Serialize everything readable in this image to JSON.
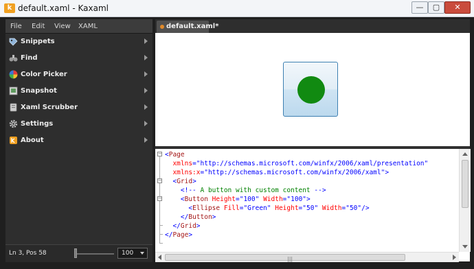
{
  "window": {
    "title": "default.xaml - Kaxaml",
    "app_icon_letter": "k",
    "minimize_glyph": "—",
    "maximize_glyph": "▢",
    "close_glyph": "✕"
  },
  "menu": [
    "File",
    "Edit",
    "View",
    "XAML"
  ],
  "sidebar": {
    "items": [
      {
        "label": "Snippets",
        "icon": "snippets-icon"
      },
      {
        "label": "Find",
        "icon": "binoculars-icon"
      },
      {
        "label": "Color Picker",
        "icon": "color-wheel-icon"
      },
      {
        "label": "Snapshot",
        "icon": "snapshot-icon"
      },
      {
        "label": "Xaml Scrubber",
        "icon": "scrubber-icon"
      },
      {
        "label": "Settings",
        "icon": "gear-icon"
      },
      {
        "label": "About",
        "icon": "kaxaml-logo-icon"
      }
    ]
  },
  "status": {
    "position": "Ln 3, Pos 58",
    "zoom": "100"
  },
  "tab": {
    "label": "default.xaml*"
  },
  "preview": {
    "ellipse_color": "#118a11",
    "button_border_color": "#3c7fb1"
  },
  "editor": {
    "fold_markers": [
      "−",
      "−",
      "−"
    ],
    "lines": [
      {
        "indent": "",
        "parts": [
          [
            "sym",
            "<"
          ],
          [
            "tag",
            "Page"
          ]
        ]
      },
      {
        "indent": "  ",
        "parts": [
          [
            "attr",
            "xmlns"
          ],
          [
            "sym",
            "="
          ],
          [
            "val",
            "\"http://schemas.microsoft.com/winfx/2006/xaml/presentation\""
          ]
        ]
      },
      {
        "indent": "  ",
        "parts": [
          [
            "attr",
            "xmlns:x"
          ],
          [
            "sym",
            "="
          ],
          [
            "val",
            "\"http://schemas.microsoft.com/winfx/2006/xaml\""
          ],
          [
            "sym",
            ">"
          ]
        ]
      },
      {
        "indent": "  ",
        "parts": [
          [
            "sym",
            "<"
          ],
          [
            "tag",
            "Grid"
          ],
          [
            "sym",
            ">"
          ]
        ]
      },
      {
        "indent": "    ",
        "parts": [
          [
            "sym",
            "<!--"
          ],
          [
            "cmt",
            " A button with custom content "
          ],
          [
            "sym",
            "-->"
          ]
        ]
      },
      {
        "indent": "    ",
        "parts": [
          [
            "sym",
            "<"
          ],
          [
            "tag",
            "Button"
          ],
          [
            "attr",
            " Height"
          ],
          [
            "sym",
            "="
          ],
          [
            "val",
            "\"100\""
          ],
          [
            "attr",
            " Width"
          ],
          [
            "sym",
            "="
          ],
          [
            "val",
            "\"100\""
          ],
          [
            "sym",
            ">"
          ]
        ]
      },
      {
        "indent": "      ",
        "parts": [
          [
            "sym",
            "<"
          ],
          [
            "tag",
            "Ellipse"
          ],
          [
            "attr",
            " Fill"
          ],
          [
            "sym",
            "="
          ],
          [
            "val",
            "\"Green\""
          ],
          [
            "attr",
            " Height"
          ],
          [
            "sym",
            "="
          ],
          [
            "val",
            "\"50\""
          ],
          [
            "attr",
            " Width"
          ],
          [
            "sym",
            "="
          ],
          [
            "val",
            "\"50\""
          ],
          [
            "sym",
            "/>"
          ]
        ]
      },
      {
        "indent": "    ",
        "parts": [
          [
            "sym",
            "</"
          ],
          [
            "tag",
            "Button"
          ],
          [
            "sym",
            ">"
          ]
        ]
      },
      {
        "indent": "  ",
        "parts": [
          [
            "sym",
            "</"
          ],
          [
            "tag",
            "Grid"
          ],
          [
            "sym",
            ">"
          ]
        ]
      },
      {
        "indent": "",
        "parts": [
          [
            "sym",
            "</"
          ],
          [
            "tag",
            "Page"
          ],
          [
            "sym",
            ">"
          ]
        ]
      }
    ]
  },
  "scroll": {
    "grip_glyph": "|||"
  }
}
